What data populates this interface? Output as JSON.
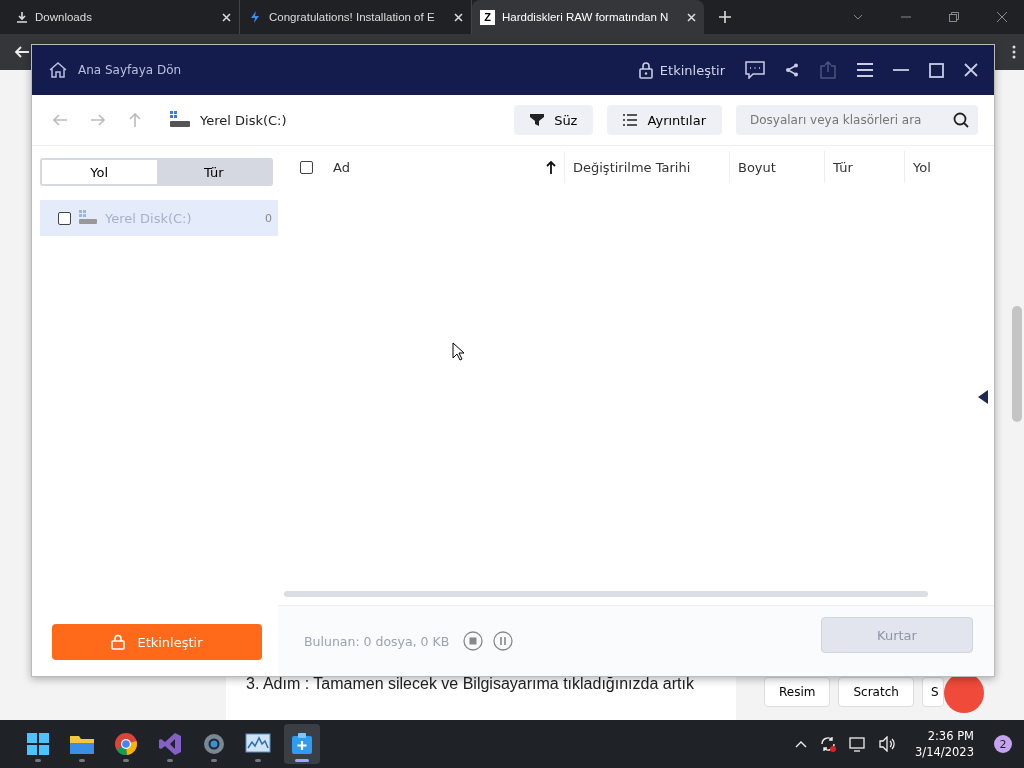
{
  "browser": {
    "tabs": [
      {
        "title": "Downloads",
        "kind": "download",
        "selected": false
      },
      {
        "title": "Congratulations! Installation of E",
        "kind": "brand",
        "selected": false
      },
      {
        "title": "Harddiskleri RAW formatından N",
        "kind": "letter",
        "badge": "Z",
        "selected": true
      }
    ],
    "page": {
      "article_text": "3. Adım : Tamamen silecek ve Bilgisayarıma tıkladığınızda artık",
      "tags": [
        "Resim",
        "Scratch",
        "S"
      ]
    }
  },
  "app": {
    "home_link": "Ana Sayfaya Dön",
    "activate_link": "Etkinleştir",
    "path": "Yerel Disk(C:)",
    "filter_button": "Süz",
    "view_button": "Ayrıntılar",
    "search": {
      "placeholder": "Dosyaları veya klasörleri ara"
    },
    "sidebar_tabs": [
      {
        "label": "Yol",
        "selected": true
      },
      {
        "label": "Tür",
        "selected": false
      }
    ],
    "tree": [
      {
        "label": "Yerel Disk(C:)",
        "count": "0",
        "checked": false,
        "selected": true
      }
    ],
    "all_checked": false,
    "columns": [
      {
        "label": "Ad",
        "sorted": true
      },
      {
        "label": "Değiştirilme Tarihi",
        "sorted": false
      },
      {
        "label": "Boyut",
        "sorted": false
      },
      {
        "label": "Tür",
        "sorted": false
      },
      {
        "label": "Yol",
        "sorted": false
      }
    ],
    "activate_button": "Etkinleştir",
    "status": "Bulunan: 0 dosya, 0 KB",
    "recover_button": {
      "label": "Kurtar",
      "disabled": true
    }
  },
  "taskbar": {
    "apps": [
      {
        "kind": "start",
        "active": false
      },
      {
        "kind": "folder",
        "active": false
      },
      {
        "kind": "browser",
        "active": false
      },
      {
        "kind": "studio",
        "active": false
      },
      {
        "kind": "settings",
        "active": false
      },
      {
        "kind": "monitor",
        "active": false
      },
      {
        "kind": "recovery",
        "active": true
      }
    ],
    "time": "2:36 PM",
    "date": "3/14/2023",
    "notifications": "2"
  }
}
